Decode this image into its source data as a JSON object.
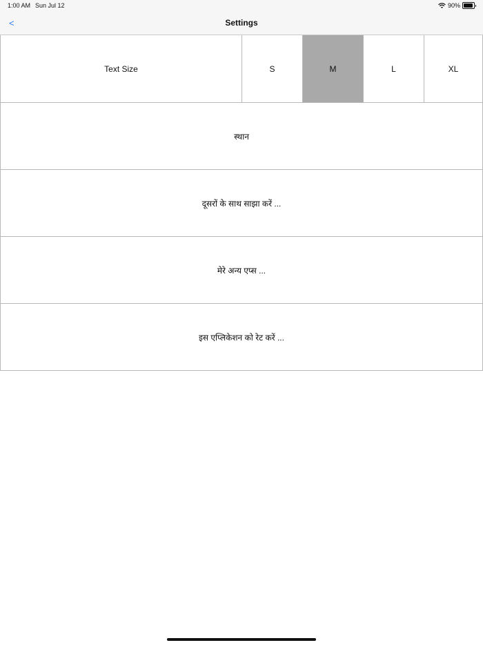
{
  "status_bar": {
    "time": "1:00 AM",
    "date": "Sun Jul 12",
    "battery_percent": "90%",
    "battery_level": 0.9,
    "wifi_icon": "wifi-icon",
    "battery_icon": "battery-icon"
  },
  "nav": {
    "back_label": "<",
    "title": "Settings",
    "accent_color": "#2f7df6"
  },
  "text_size": {
    "label": "Text Size",
    "options": [
      "S",
      "M",
      "L",
      "XL"
    ],
    "selected": "M",
    "selected_color": "#a9a9a9"
  },
  "rows": [
    {
      "label": "स्थान"
    },
    {
      "label": "दूसरों के साथ साझा करें ..."
    },
    {
      "label": "मेरे अन्य एप्स ..."
    },
    {
      "label": "इस एप्लिकेशन को रेट करें ..."
    }
  ]
}
